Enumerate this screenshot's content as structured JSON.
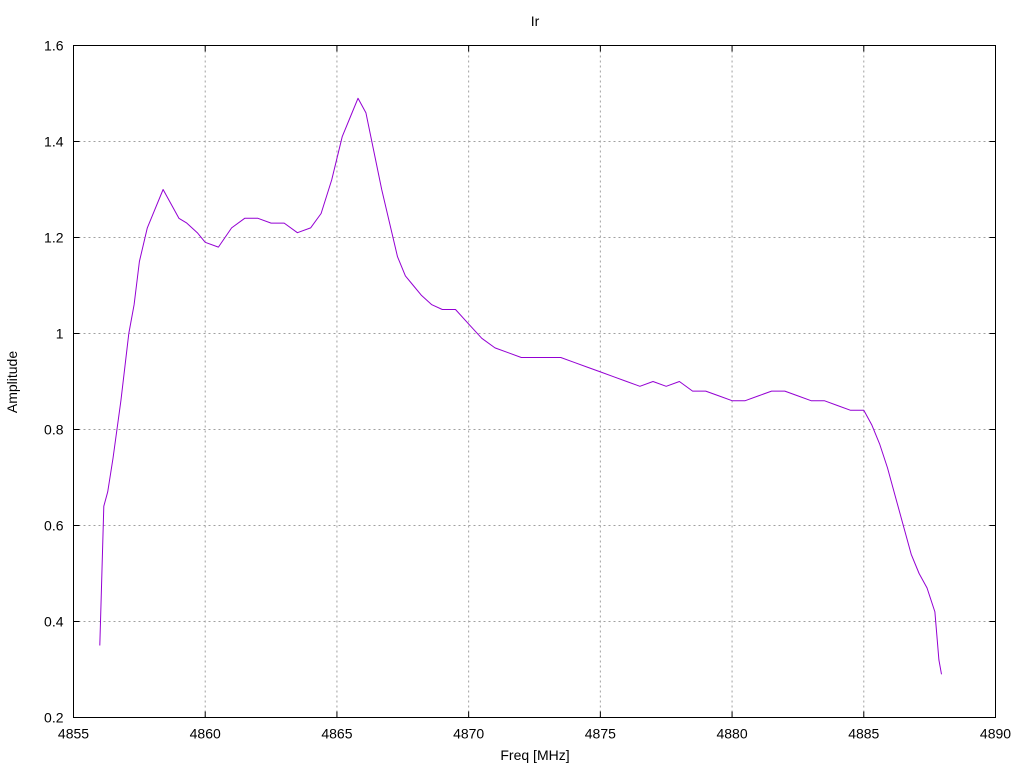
{
  "chart_data": {
    "type": "line",
    "title": "Ir",
    "xlabel": "Freq [MHz]",
    "ylabel": "Amplitude",
    "xlim": [
      4855,
      4890
    ],
    "ylim": [
      0.2,
      1.6
    ],
    "xticks": [
      4855,
      4860,
      4865,
      4870,
      4875,
      4880,
      4885,
      4890
    ],
    "yticks": [
      0.2,
      0.4,
      0.6,
      0.8,
      1,
      1.2,
      1.4,
      1.6
    ],
    "xtick_labels": [
      "4855",
      "4860",
      "4865",
      "4870",
      "4875",
      "4880",
      "4885",
      "4890"
    ],
    "ytick_labels": [
      "0.2",
      "0.4",
      "0.6",
      "0.8",
      "1",
      "1.2",
      "1.4",
      "1.6"
    ],
    "grid": true,
    "series": [
      {
        "color": "#9400d3",
        "x": [
          4856.0,
          4856.05,
          4856.15,
          4856.3,
          4856.5,
          4856.8,
          4857.1,
          4857.3,
          4857.5,
          4857.8,
          4858.1,
          4858.4,
          4858.7,
          4859.0,
          4859.3,
          4859.7,
          4860.0,
          4860.5,
          4861.0,
          4861.5,
          4862.0,
          4862.5,
          4863.0,
          4863.5,
          4864.0,
          4864.4,
          4864.8,
          4865.2,
          4865.5,
          4865.8,
          4866.1,
          4866.4,
          4866.7,
          4867.0,
          4867.3,
          4867.6,
          4867.9,
          4868.2,
          4868.6,
          4869.0,
          4869.5,
          4870.0,
          4870.5,
          4871.0,
          4871.5,
          4872.0,
          4872.5,
          4873.0,
          4873.5,
          4874.0,
          4874.5,
          4875.0,
          4875.5,
          4876.0,
          4876.5,
          4877.0,
          4877.5,
          4878.0,
          4878.5,
          4879.0,
          4879.5,
          4880.0,
          4880.5,
          4881.0,
          4881.5,
          4882.0,
          4882.5,
          4883.0,
          4883.5,
          4884.0,
          4884.5,
          4885.0,
          4885.3,
          4885.6,
          4885.9,
          4886.2,
          4886.5,
          4886.8,
          4887.1,
          4887.4,
          4887.7,
          4887.85,
          4887.95
        ],
        "y": [
          0.35,
          0.45,
          0.64,
          0.67,
          0.74,
          0.86,
          1.0,
          1.06,
          1.15,
          1.22,
          1.26,
          1.3,
          1.27,
          1.24,
          1.23,
          1.21,
          1.19,
          1.18,
          1.22,
          1.24,
          1.24,
          1.23,
          1.23,
          1.21,
          1.22,
          1.25,
          1.32,
          1.41,
          1.45,
          1.49,
          1.46,
          1.38,
          1.3,
          1.23,
          1.16,
          1.12,
          1.1,
          1.08,
          1.06,
          1.05,
          1.05,
          1.02,
          0.99,
          0.97,
          0.96,
          0.95,
          0.95,
          0.95,
          0.95,
          0.94,
          0.93,
          0.92,
          0.91,
          0.9,
          0.89,
          0.9,
          0.89,
          0.9,
          0.88,
          0.88,
          0.87,
          0.86,
          0.86,
          0.87,
          0.88,
          0.88,
          0.87,
          0.86,
          0.86,
          0.85,
          0.84,
          0.84,
          0.81,
          0.77,
          0.72,
          0.66,
          0.6,
          0.54,
          0.5,
          0.47,
          0.42,
          0.32,
          0.29
        ]
      }
    ]
  }
}
